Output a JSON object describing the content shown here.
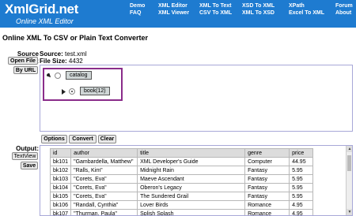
{
  "header": {
    "logo_title": "XmlGrid.net",
    "logo_subtitle": "Online XML Editor",
    "nav": [
      [
        "Demo",
        "FAQ"
      ],
      [
        "XML Editor",
        "XML Viewer"
      ],
      [
        "XML To Text",
        "CSV To XML"
      ],
      [
        "XSD To XML",
        "XML To XSD"
      ],
      [
        "XPath",
        "Excel To XML"
      ],
      [
        "Forum",
        "About"
      ]
    ]
  },
  "page": {
    "title": "Online XML To CSV or Plain Text Converter",
    "source_data_label": "Source Data:",
    "source_label": "Source:",
    "source_value": "test.xml",
    "file_size_label": "File Size:",
    "file_size_value": "4432",
    "open_file_label": "Open File",
    "by_url_label": "By URL"
  },
  "tree": {
    "root": "catalog",
    "child": "book(12)"
  },
  "actions": {
    "options": "Options",
    "convert": "Convert",
    "clear": "Clear"
  },
  "output": {
    "label": "Output:",
    "textview_label": "TextView",
    "save_label": "Save",
    "columns": [
      "id",
      "author",
      "title",
      "genre",
      "price"
    ],
    "rows": [
      [
        "bk101",
        "\"Gambardella, Matthew\"",
        "XML Developer's Guide",
        "Computer",
        "44.95"
      ],
      [
        "bk102",
        "\"Ralls, Kim\"",
        "Midnight Rain",
        "Fantasy",
        "5.95"
      ],
      [
        "bk103",
        "\"Corets, Eva\"",
        "Maeve Ascendant",
        "Fantasy",
        "5.95"
      ],
      [
        "bk104",
        "\"Corets, Eva\"",
        "Oberon's Legacy",
        "Fantasy",
        "5.95"
      ],
      [
        "bk105",
        "\"Corets, Eva\"",
        "The Sundered Grail",
        "Fantasy",
        "5.95"
      ],
      [
        "bk106",
        "\"Randall, Cynthia\"",
        "Lover Birds",
        "Romance",
        "4.95"
      ],
      [
        "bk107",
        "\"Thurman, Paula\"",
        "Splish Splash",
        "Romance",
        "4.95"
      ]
    ]
  },
  "colors": {
    "header_bg": "#1e7bd0",
    "tree_border": "#8a2c8a"
  }
}
